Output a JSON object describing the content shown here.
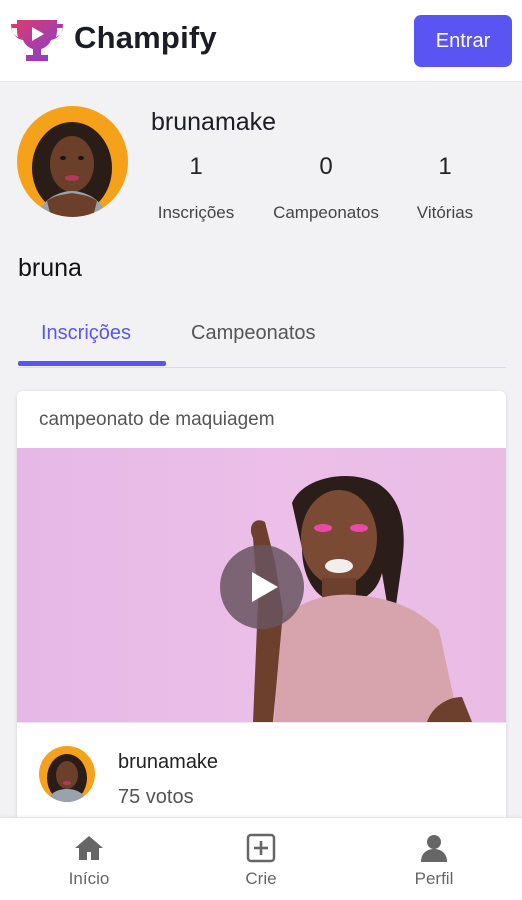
{
  "header": {
    "brand": "Champify",
    "enter_label": "Entrar"
  },
  "profile": {
    "username": "brunamake",
    "display_name": "bruna",
    "stats": [
      {
        "value": "1",
        "label": "Inscrições"
      },
      {
        "value": "0",
        "label": "Campeonatos"
      },
      {
        "value": "1",
        "label": "Vitórias"
      }
    ]
  },
  "tabs": [
    {
      "label": "Inscrições",
      "active": true
    },
    {
      "label": "Campeonatos",
      "active": false
    }
  ],
  "card": {
    "title": "campeonato de maquiagem",
    "user": "brunamake",
    "votes": "75 votos"
  },
  "bottom_nav": [
    {
      "label": "Início",
      "icon": "home-icon"
    },
    {
      "label": "Crie",
      "icon": "plus-square-icon"
    },
    {
      "label": "Perfil",
      "icon": "person-icon"
    }
  ],
  "colors": {
    "accent": "#5a55f2",
    "logo_purple": "#7b3fd6",
    "logo_pink": "#e0336e"
  }
}
